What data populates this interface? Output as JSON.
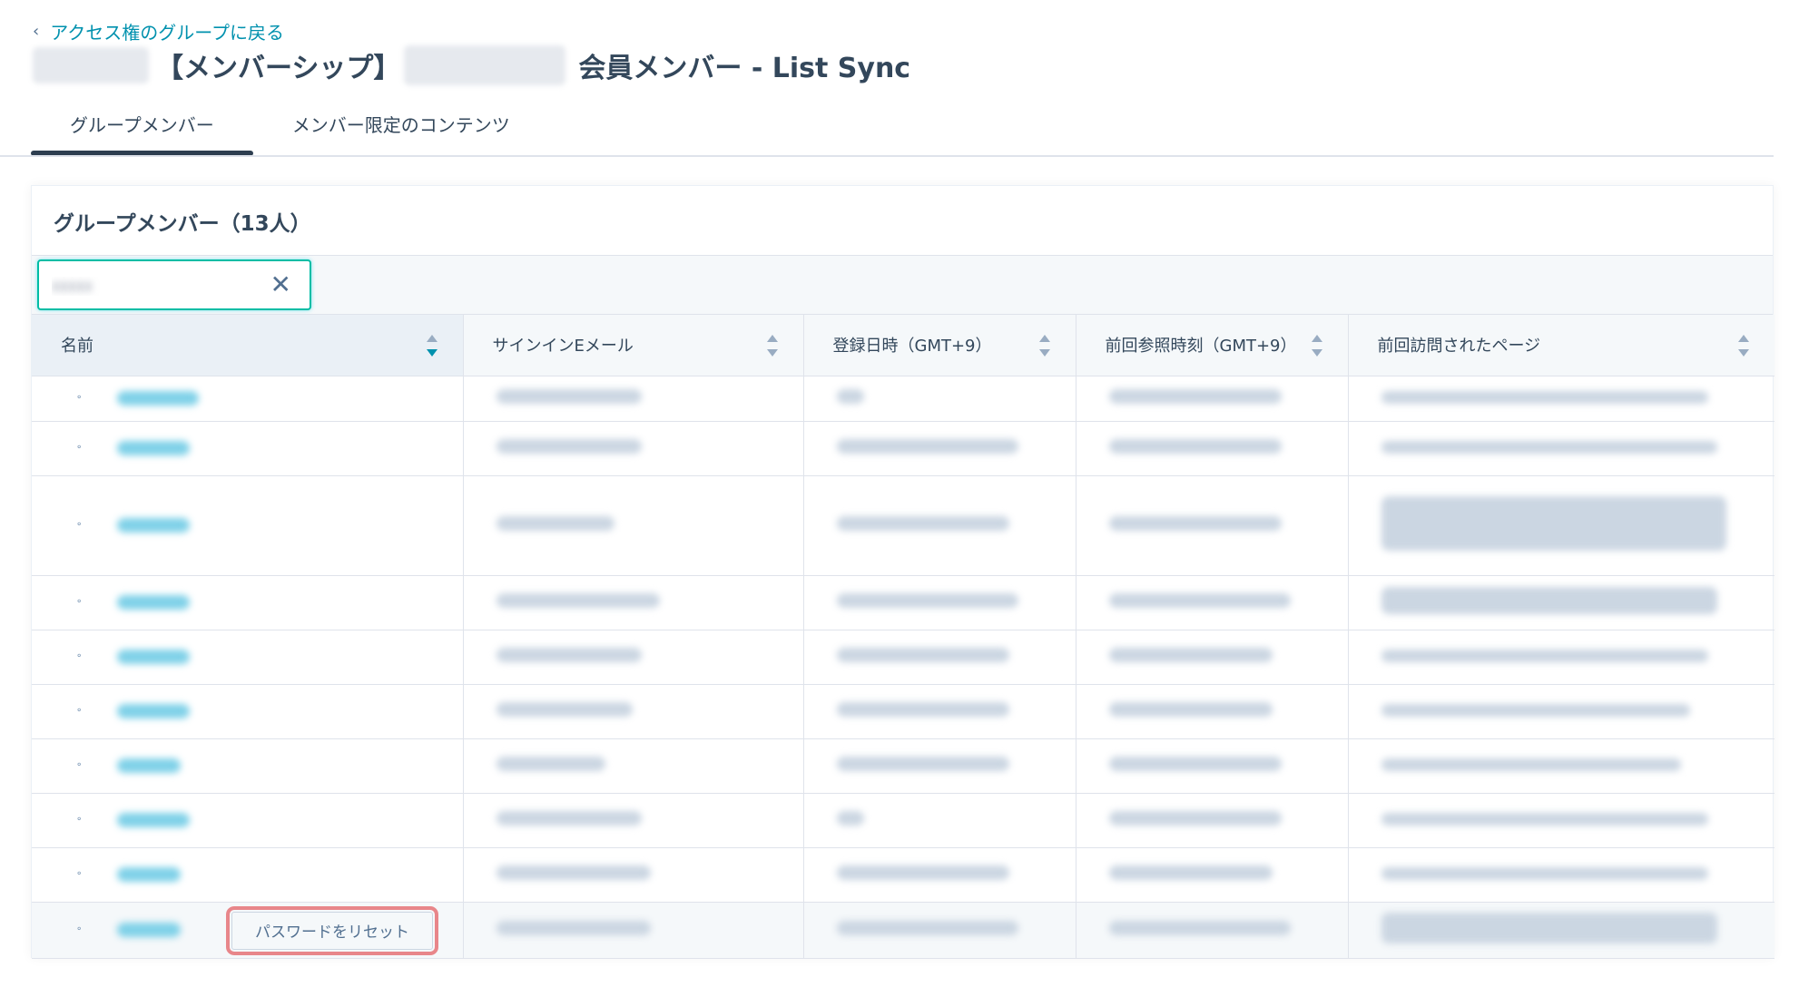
{
  "nav": {
    "back_label": "アクセス権のグループに戻る",
    "back_icon": "chevron-left-icon"
  },
  "header": {
    "title_part1": "【メンバーシップ】",
    "title_part2": "会員メンバー - List Sync"
  },
  "tabs": [
    {
      "label": "グループメンバー",
      "active": true
    },
    {
      "label": "メンバー限定のコンテンツ",
      "active": false
    }
  ],
  "card": {
    "title": "グループメンバー（13人）"
  },
  "search": {
    "clear_icon": "close-icon"
  },
  "table": {
    "columns": [
      "名前",
      "サインインEメール",
      "登録日時（GMT+9）",
      "前回参照時刻（GMT+9）",
      "前回訪問されたページ"
    ],
    "sorted_column": "名前",
    "row_count_visible": 10
  },
  "row_action": {
    "reset_password_label": "パスワードをリセット"
  },
  "colors": {
    "accent": "#0091ae",
    "focus": "#00bda5",
    "highlight": "#e8868a",
    "text": "#33475b"
  }
}
